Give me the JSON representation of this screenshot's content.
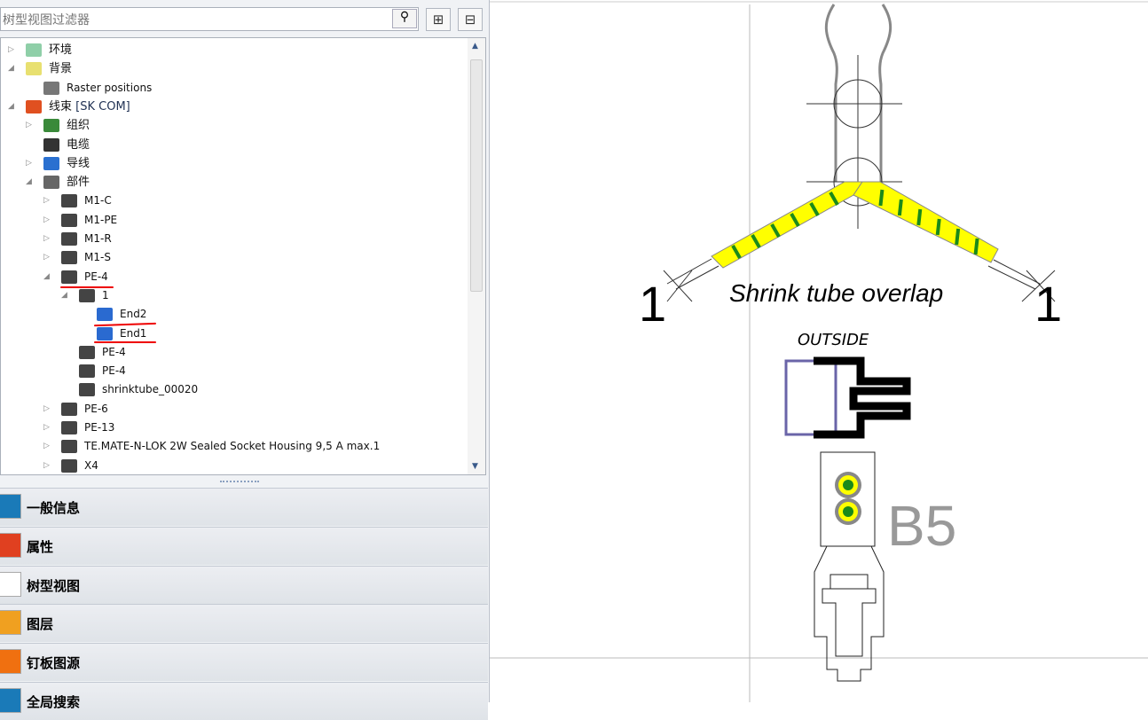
{
  "filter": {
    "placeholder": "树型视图过滤器"
  },
  "toolbar": {
    "filter_icon": "filter-icon",
    "expand_icon": "expand-all-icon",
    "collapse_icon": "collapse-all-icon"
  },
  "tree": [
    {
      "label": "环境",
      "level": 0,
      "arrow": "▷"
    },
    {
      "label": "背景",
      "level": 0,
      "arrow": "◢"
    },
    {
      "label": "Raster positions",
      "level": 1,
      "arrow": ""
    },
    {
      "label": "线束",
      "suffix": "[SK COM]",
      "level": 0,
      "arrow": "◢"
    },
    {
      "label": "组织",
      "level": 1,
      "arrow": "▷"
    },
    {
      "label": "电缆",
      "level": 1,
      "arrow": ""
    },
    {
      "label": "导线",
      "level": 1,
      "arrow": "▷"
    },
    {
      "label": "部件",
      "level": 1,
      "arrow": "◢"
    },
    {
      "label": "M1-C",
      "level": 2,
      "arrow": "▷"
    },
    {
      "label": "M1-PE",
      "level": 2,
      "arrow": "▷"
    },
    {
      "label": "M1-R",
      "level": 2,
      "arrow": "▷"
    },
    {
      "label": "M1-S",
      "level": 2,
      "arrow": "▷"
    },
    {
      "label": "PE-4",
      "level": 2,
      "arrow": "◢"
    },
    {
      "label": "1",
      "level": 3,
      "arrow": "◢"
    },
    {
      "label": "End2",
      "level": 4,
      "arrow": ""
    },
    {
      "label": "End1",
      "level": 4,
      "arrow": ""
    },
    {
      "label": "PE-4",
      "level": 3,
      "arrow": ""
    },
    {
      "label": "PE-4",
      "level": 3,
      "arrow": ""
    },
    {
      "label": "shrinktube_00020",
      "level": 3,
      "arrow": ""
    },
    {
      "label": "PE-6",
      "level": 2,
      "arrow": "▷"
    },
    {
      "label": "PE-13",
      "level": 2,
      "arrow": "▷"
    },
    {
      "label": "TE.MATE-N-LOK 2W Sealed Socket Housing 9,5 A max.1",
      "level": 2,
      "arrow": "▷"
    },
    {
      "label": "X4",
      "level": 2,
      "arrow": "▷"
    }
  ],
  "sections": [
    {
      "label": "一般信息",
      "icon": "info-icon"
    },
    {
      "label": "属性",
      "icon": "properties-icon"
    },
    {
      "label": "树型视图",
      "icon": "tree-view-icon"
    },
    {
      "label": "图层",
      "icon": "layers-icon"
    },
    {
      "label": "钉板图源",
      "icon": "nailboard-icon"
    },
    {
      "label": "全局搜索",
      "icon": "search-icon"
    }
  ],
  "drawing": {
    "caption": "Shrink tube overlap",
    "left_count": "1",
    "right_count": "1",
    "outside_label": "OUTSIDE",
    "connector_label": "B5",
    "colors": {
      "tube_yellow": "#ffff00",
      "tube_green": "#1a8a1a"
    }
  }
}
